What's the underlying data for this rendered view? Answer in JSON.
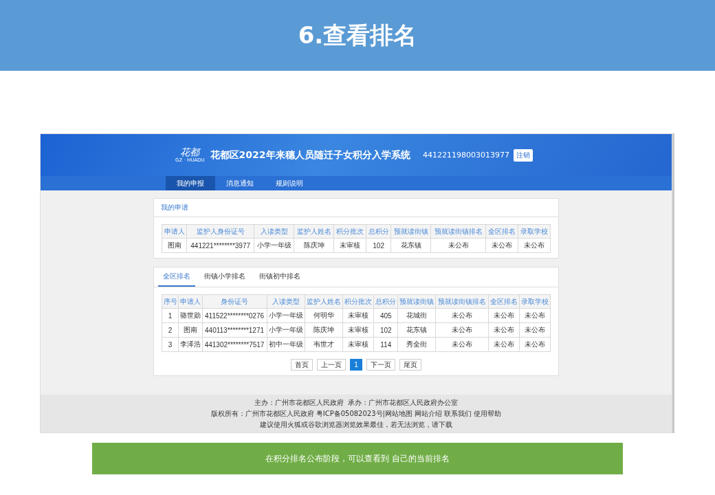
{
  "slide_title": "6.查看排名",
  "app": {
    "logo": {
      "mark": "花都",
      "sub": "GZ · HUADU"
    },
    "title": "花都区2022年来穗人员随迁子女积分入学系统",
    "user_id": "441221198003013977",
    "logout": "注销"
  },
  "nav": [
    {
      "label": "我的申报",
      "selected": true
    },
    {
      "label": "消息通知",
      "selected": false
    },
    {
      "label": "规则说明",
      "selected": false
    }
  ],
  "my_application": {
    "title": "我的申请",
    "columns": [
      "申请人",
      "监护人身份证号",
      "入读类型",
      "监护人姓名",
      "积分批次",
      "总积分",
      "预就读街镇",
      "预就读街镇排名",
      "全区排名",
      "录取学校"
    ],
    "rows": [
      [
        "图南",
        "441221********3977",
        "小学一年级",
        "陈庆坤",
        "未审核",
        "102",
        "花东镇",
        "未公布",
        "未公布",
        "未公布"
      ]
    ]
  },
  "ranking": {
    "tabs": [
      {
        "label": "全区排名",
        "selected": true
      },
      {
        "label": "街镇小学排名",
        "selected": false
      },
      {
        "label": "街镇初中排名",
        "selected": false
      }
    ],
    "columns": [
      "序号",
      "申请人",
      "身份证号",
      "入读类型",
      "监护人姓名",
      "积分批次",
      "总积分",
      "预就读街镇",
      "预就读街镇排名",
      "全区排名",
      "录取学校"
    ],
    "rows": [
      [
        "1",
        "骆世勋",
        "411522********0276",
        "小学一年级",
        "何明华",
        "未审核",
        "405",
        "花城街",
        "未公布",
        "未公布",
        "未公布"
      ],
      [
        "2",
        "图南",
        "440113********1271",
        "小学一年级",
        "陈庆坤",
        "未审核",
        "102",
        "花东镇",
        "未公布",
        "未公布",
        "未公布"
      ],
      [
        "3",
        "李泽浩",
        "441302********7517",
        "初中一年级",
        "韦世才",
        "未审核",
        "114",
        "秀全街",
        "未公布",
        "未公布",
        "未公布"
      ]
    ],
    "pagination": [
      {
        "label": "首页",
        "selected": false
      },
      {
        "label": "上一页",
        "selected": false
      },
      {
        "label": "1",
        "selected": true
      },
      {
        "label": "下一页",
        "selected": false
      },
      {
        "label": "尾页",
        "selected": false
      }
    ]
  },
  "footer": [
    "主办：广州市花都区人民政府  承办：广州市花都区人民政府办公室",
    "版权所有：广州市花都区人民政府 粤ICP备05082023号|网站地图 网站介绍 联系我们 使用帮助",
    "建议使用火狐或谷歌浏览器浏览效果最佳，若无法浏览，请下载"
  ],
  "caption": "在积分排名公布阶段，可以查看到 自己的当前排名"
}
